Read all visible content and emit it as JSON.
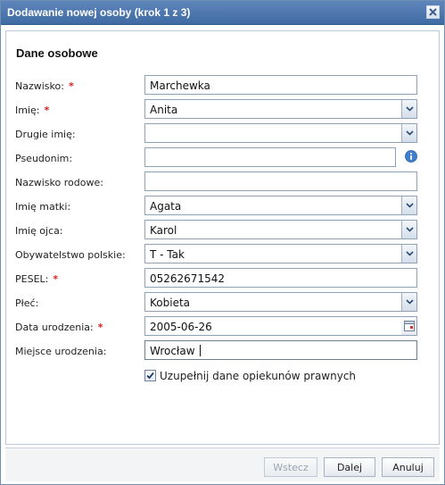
{
  "window": {
    "title": "Dodawanie nowej osoby (krok 1 z 3)",
    "close_icon": "close-icon"
  },
  "section": {
    "title": "Dane osobowe"
  },
  "form": {
    "nazwisko": {
      "label": "Nazwisko:",
      "required": "*",
      "value": "Marchewka"
    },
    "imie": {
      "label": "Imię:",
      "required": "*",
      "value": "Anita"
    },
    "drugie_imie": {
      "label": "Drugie imię:",
      "value": ""
    },
    "pseudonim": {
      "label": "Pseudonim:",
      "value": ""
    },
    "nazwisko_rodowe": {
      "label": "Nazwisko rodowe:",
      "value": ""
    },
    "imie_matki": {
      "label": "Imię matki:",
      "value": "Agata"
    },
    "imie_ojca": {
      "label": "Imię ojca:",
      "value": "Karol"
    },
    "obywatelstwo": {
      "label": "Obywatelstwo polskie:",
      "value": "T - Tak"
    },
    "pesel": {
      "label": "PESEL:",
      "required": "*",
      "value": "05262671542"
    },
    "plec": {
      "label": "Płeć:",
      "value": "Kobieta"
    },
    "data_urodzenia": {
      "label": "Data urodzenia:",
      "required": "*",
      "value": "2005-06-26"
    },
    "miejsce_urodzenia": {
      "label": "Miejsce urodzenia:",
      "value": "Wrocław"
    },
    "uzupelnij": {
      "label": "Uzupełnij dane opiekunów prawnych",
      "checked": true
    }
  },
  "footer": {
    "back_label": "Wstecz",
    "next_label": "Dalej",
    "cancel_label": "Anuluj"
  },
  "colors": {
    "titlebar": "#4a74ab",
    "required": "#e01b1b",
    "info": "#3f7fd0"
  }
}
